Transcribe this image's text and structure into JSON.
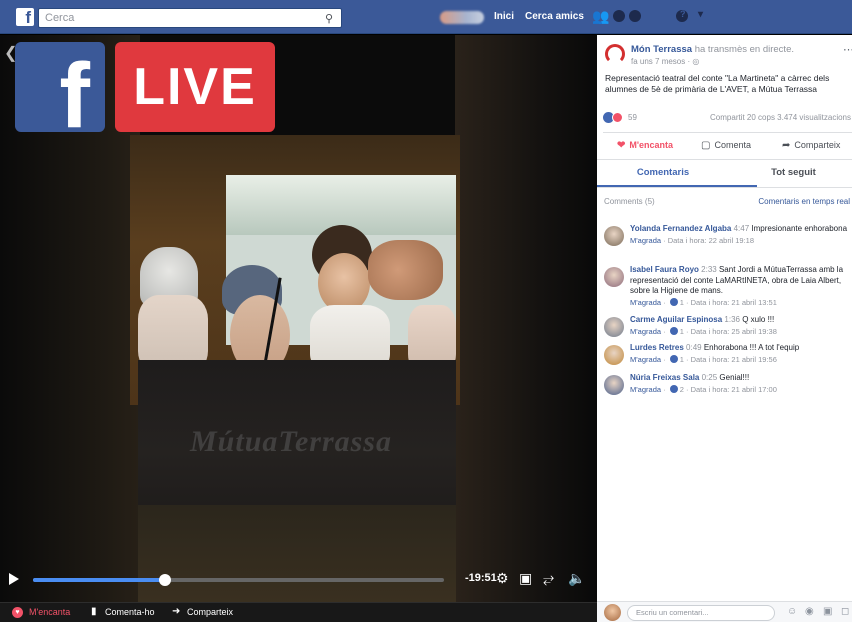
{
  "topbar": {
    "logo_letter": "f",
    "search_placeholder": "Cerca",
    "nav": [
      "Inici",
      "Cerca amics"
    ],
    "help_glyph": "?",
    "dropdown_glyph": "▾"
  },
  "overlay": {
    "fb_letter": "f",
    "live_label": "LIVE"
  },
  "video": {
    "watermark": "MútuaTerrassa",
    "progress": 0.32,
    "time_remaining": "-19:51"
  },
  "bottom_bar": {
    "like": "M'encanta",
    "comment": "Comenta-ho",
    "share": "Comparteix"
  },
  "post": {
    "page_name": "Món Terrassa",
    "action_text": "ha transmès en directe.",
    "meta": "fa uns 7 mesos · ",
    "text": "Representació teatral del conte \"La Martineta\" a càrrec dels alumnes de 5è de primària de L'AVET, a Mútua Terrassa",
    "reaction_count": "59",
    "share_stats": "Compartit 20 cops  3.474 visualitzacions",
    "actions": {
      "love": "M'encanta",
      "comment": "Comenta",
      "share": "Comparteix"
    },
    "tabs": [
      "Comentaris",
      "Tot seguit"
    ],
    "comments_count_label": "Comments (5)",
    "comments_live_label": "Comentaris en temps real"
  },
  "comments": [
    {
      "author": "Yolanda Fernandez Algaba",
      "time": "4:47",
      "text": "Impresionante enhorabona",
      "like_label": "M'agrada",
      "likes": "",
      "date": "Data i hora: 22 abril 19:18",
      "avatar_color": "#7a6a58"
    },
    {
      "author": "Isabel Faura Royo",
      "time": "2:33",
      "text": "Sant Jordi a MútuaTerrassa amb la representació del conte LaMARtINETA, obra de Laia Albert, sobre la Higiene de mans.",
      "like_label": "M'agrada",
      "likes": "1",
      "date": "Data i hora: 21 abril 13:51",
      "avatar_color": "#8d6a7a"
    },
    {
      "author": "Carme Aguilar Espinosa",
      "time": "1:36",
      "text": "Q xulo !!!",
      "like_label": "M'agrada",
      "likes": "1",
      "date": "Data i hora: 25 abril 19:38",
      "avatar_color": "#6e7a8c"
    },
    {
      "author": "Lurdes Retres",
      "time": "0:49",
      "text": "Enhorabona !!! A tot l'equip",
      "like_label": "M'agrada",
      "likes": "1",
      "date": "Data i hora: 21 abril 19:56",
      "avatar_color": "#c0883a"
    },
    {
      "author": "Núria Freixas Sala",
      "time": "0:25",
      "text": "Genial!!!",
      "like_label": "M'agrada",
      "likes": "2",
      "date": "Data i hora: 21 abril 17:00",
      "avatar_color": "#4b5f8a"
    }
  ],
  "composer": {
    "placeholder": "Escriu un comentari..."
  },
  "colors": {
    "facebook_blue": "#3b5998",
    "live_red": "#e0393e",
    "progress_blue": "#4a8df2",
    "link_blue": "#365899",
    "love_red": "#f25268"
  }
}
